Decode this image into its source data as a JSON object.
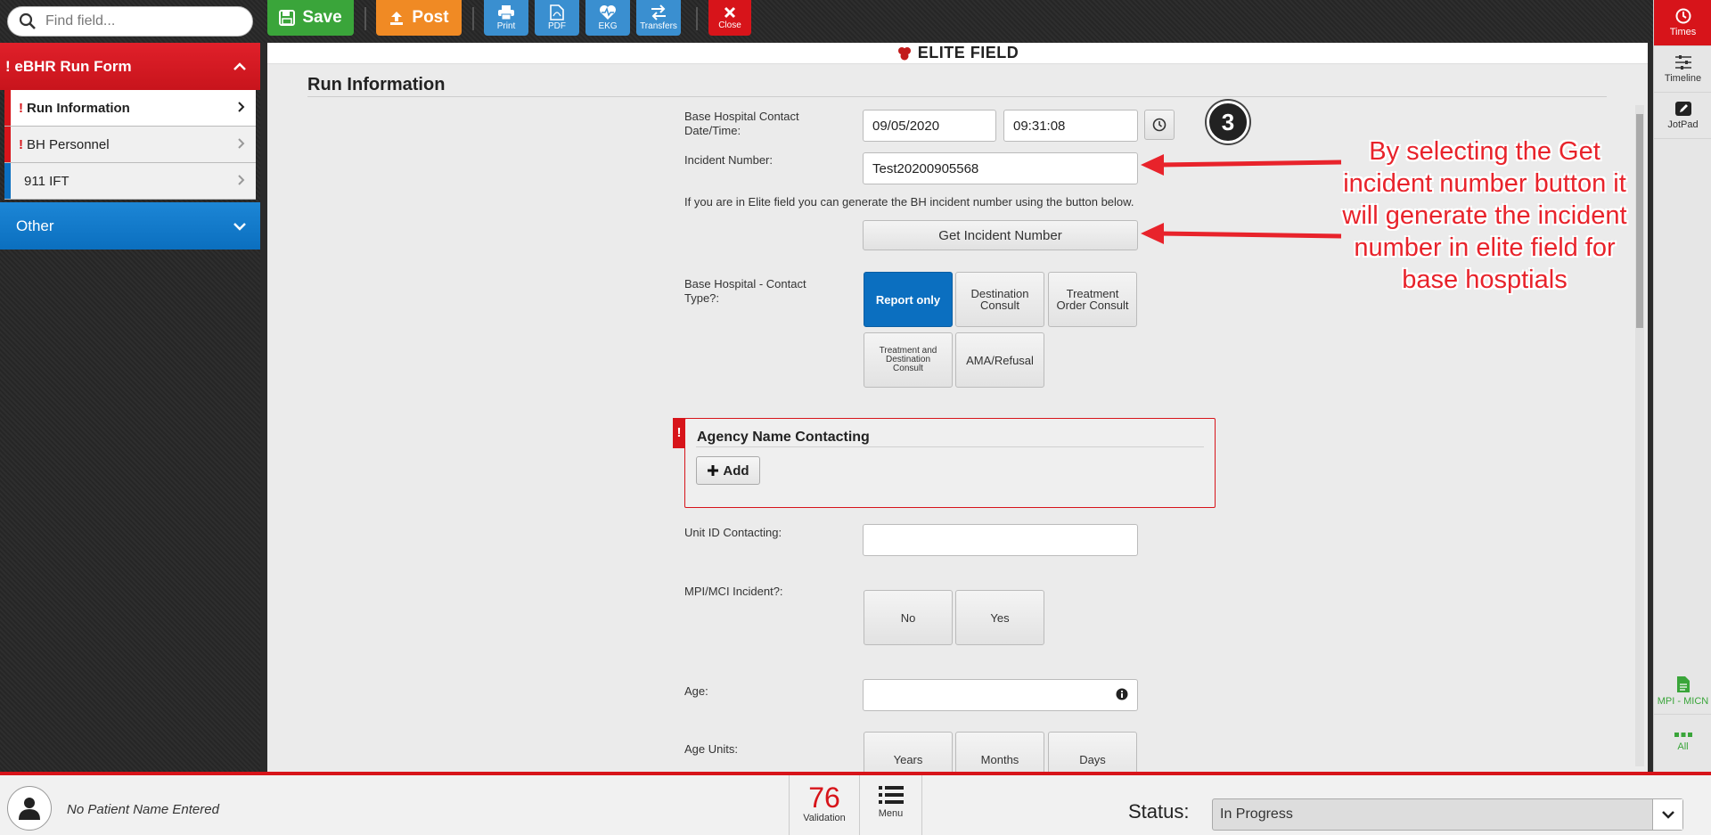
{
  "toolbar": {
    "search_placeholder": "Find field...",
    "save_label": "Save",
    "post_label": "Post",
    "print_label": "Print",
    "pdf_label": "PDF",
    "ekg_label": "EKG",
    "transfers_label": "Transfers",
    "close_label": "Close"
  },
  "sidebar": {
    "form_title": "eBHR Run Form",
    "items": [
      {
        "label": "Run Information",
        "required": true,
        "active": true
      },
      {
        "label": "BH Personnel",
        "required": true,
        "active": false
      },
      {
        "label": "911 IFT",
        "required": false,
        "active": false
      }
    ],
    "other_label": "Other"
  },
  "brand": {
    "name": "ELITE FIELD"
  },
  "section": {
    "title": "Run Information"
  },
  "form": {
    "contact_datetime_label": "Base Hospital Contact Date/Time:",
    "contact_date": "09/05/2020",
    "contact_time": "09:31:08",
    "incident_number_label": "Incident Number:",
    "incident_number": "Test20200905568",
    "info_note": "If you are in Elite field you can generate the BH incident number using the button below.",
    "get_incident_label": "Get Incident Number",
    "contact_type_label": "Base Hospital - Contact Type?:",
    "contact_types": [
      "Report only",
      "Destination Consult",
      "Treatment Order Consult",
      "Treatment and Destination Consult",
      "AMA/Refusal"
    ],
    "contact_type_selected": "Report only",
    "agency_title": "Agency Name Contacting",
    "add_label": "Add",
    "unit_id_label": "Unit ID Contacting:",
    "unit_id_value": "",
    "mpi_label": "MPI/MCI Incident?:",
    "mpi_options": [
      "No",
      "Yes"
    ],
    "age_label": "Age:",
    "age_value": "",
    "age_units_label": "Age Units:",
    "age_units": [
      "Years",
      "Months",
      "Days"
    ]
  },
  "annotation": {
    "step": "3",
    "text": "By selecting the Get incident number button it will generate the incident number in elite field for base hosptials"
  },
  "right_rail": {
    "times_label": "Times",
    "timeline_label": "Timeline",
    "jotpad_label": "JotPad",
    "mpi_label": "MPI - MICN",
    "all_label": "All"
  },
  "footer": {
    "patient_name": "No Patient Name Entered",
    "validation_count": "76",
    "validation_label": "Validation",
    "menu_label": "Menu",
    "status_label": "Status:",
    "status_value": "In Progress"
  },
  "colors": {
    "accent_red": "#d7141a",
    "accent_blue": "#0b6fc0",
    "save_green": "#3aa53a",
    "post_orange": "#f08a24",
    "annotation_red": "#e8232b"
  }
}
